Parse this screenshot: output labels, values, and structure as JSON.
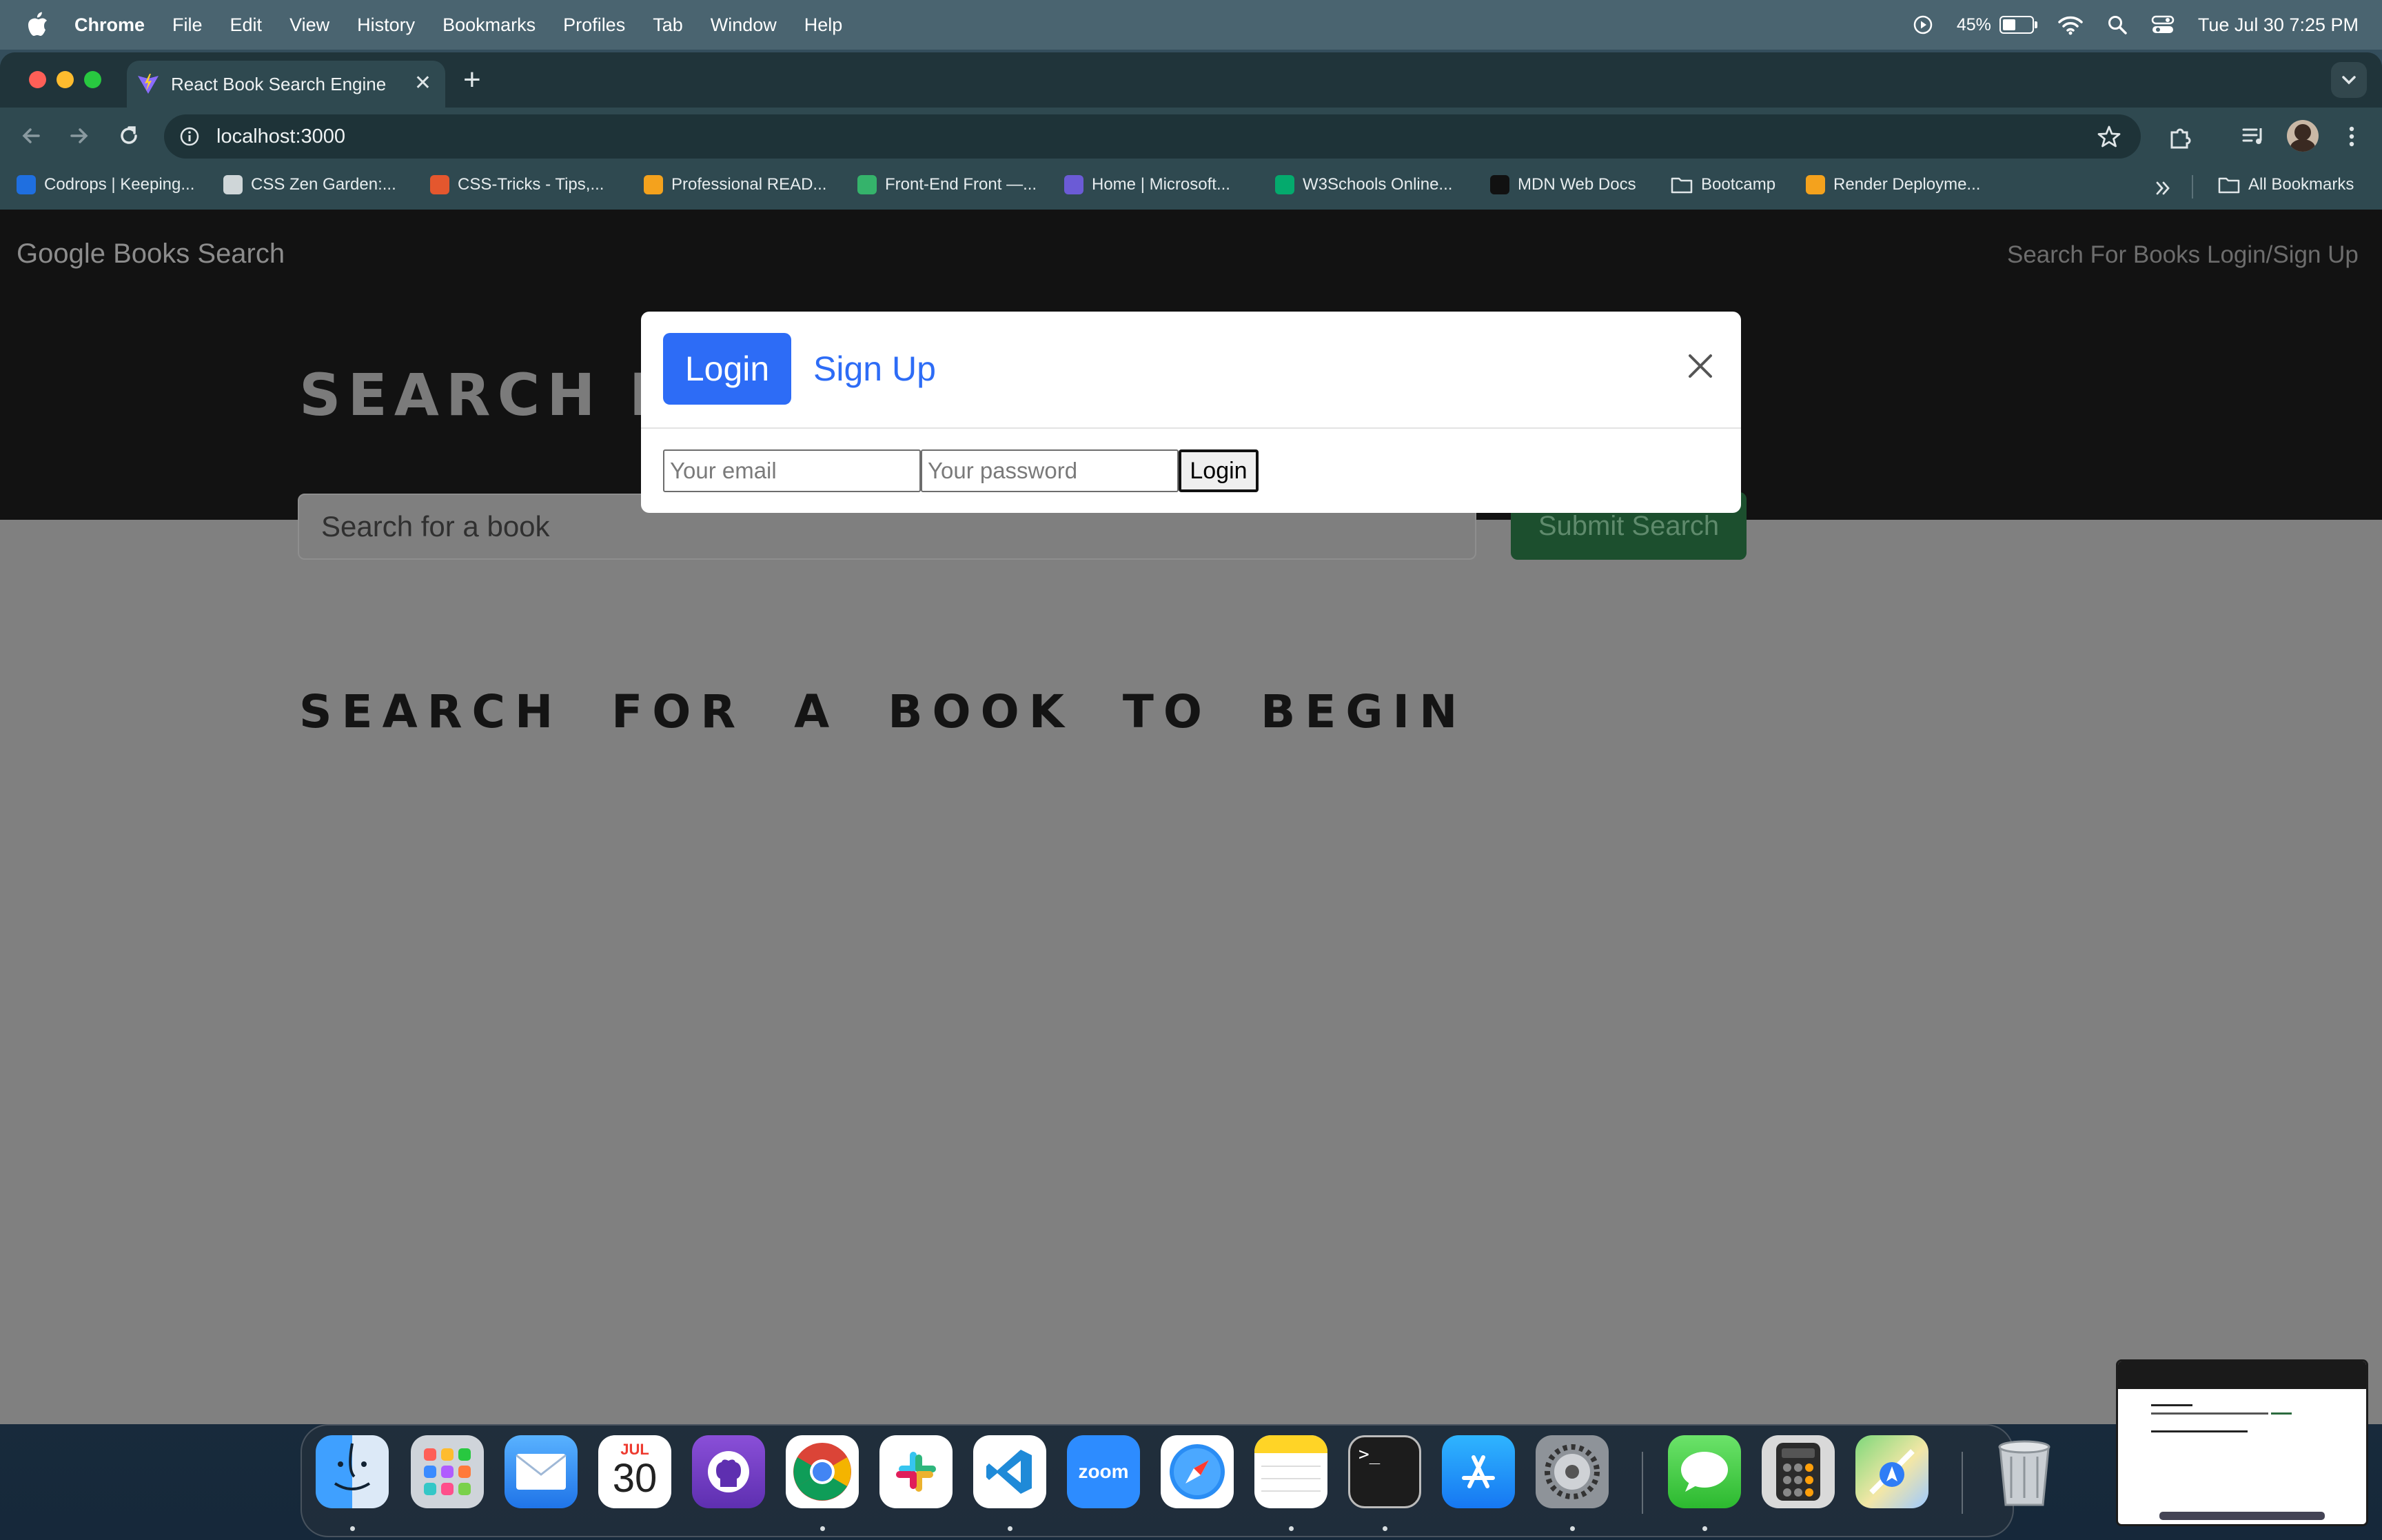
{
  "menubar": {
    "app_name": "Chrome",
    "items": [
      "File",
      "Edit",
      "View",
      "History",
      "Bookmarks",
      "Profiles",
      "Tab",
      "Window",
      "Help"
    ],
    "battery_percent": "45%",
    "battery_level": 0.45,
    "datetime": "Tue Jul 30  7:25 PM"
  },
  "browser": {
    "tab_title": "React Book Search Engine",
    "url": "localhost:3000",
    "bookmarks": [
      {
        "label": "Codrops | Keeping...",
        "color": "#1f6fe0"
      },
      {
        "label": "CSS Zen Garden:...",
        "color": "#cfd6d8"
      },
      {
        "label": "CSS-Tricks - Tips,...",
        "color": "#e4572e"
      },
      {
        "label": "Professional READ...",
        "color": "#f4a21d"
      },
      {
        "label": "Front-End Front —...",
        "color": "#35b36b"
      },
      {
        "label": "Home | Microsoft...",
        "color": "#6b5bd6"
      },
      {
        "label": "W3Schools Online...",
        "color": "#04aa6d"
      },
      {
        "label": "MDN Web Docs",
        "color": "#111111"
      },
      {
        "label": "Bootcamp",
        "color": "folder"
      },
      {
        "label": "Render Deployme...",
        "color": "#f4a21d"
      }
    ],
    "all_bookmarks": "All Bookmarks"
  },
  "page": {
    "brand": "Google Books Search",
    "nav": {
      "search": "Search For Books",
      "login": "Login/Sign Up"
    },
    "hero_title": "SEARCH FOR BOOKS!",
    "search_placeholder": "Search for a book",
    "submit_label": "Submit Search",
    "empty_message": "SEARCH FOR A BOOK TO BEGIN"
  },
  "modal": {
    "tab_login": "Login",
    "tab_signup": "Sign Up",
    "email_placeholder": "Your email",
    "password_placeholder": "Your password",
    "submit_label": "Login"
  },
  "dock": {
    "calendar_month": "JUL",
    "calendar_day": "30",
    "zoom_label": "zoom",
    "apps": [
      "finder-icon",
      "launchpad-icon",
      "mail-icon",
      "calendar-icon",
      "github-desktop-icon",
      "chrome-icon",
      "slack-icon",
      "vscode-icon",
      "zoom-icon",
      "safari-icon",
      "notes-icon",
      "terminal-icon",
      "app-store-icon",
      "system-settings-icon",
      "messages-icon",
      "calculator-icon",
      "maps-icon",
      "trash-icon"
    ]
  },
  "colors": {
    "accent": "#2d6cf6",
    "submit_green": "#1c4f2e",
    "navbar_bg": "#121212"
  }
}
